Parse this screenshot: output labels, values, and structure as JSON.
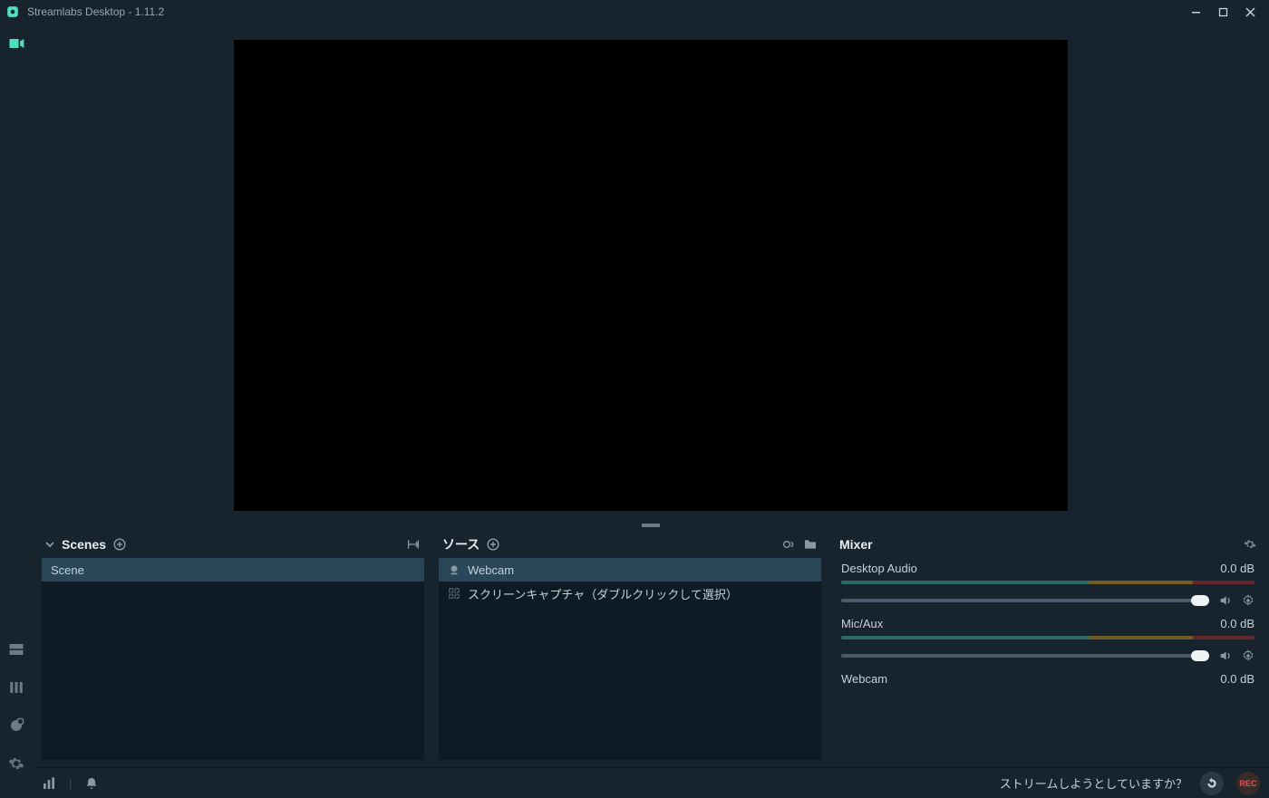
{
  "titlebar": {
    "title": "Streamlabs Desktop - 1.11.2"
  },
  "panels": {
    "scenes": {
      "title": "Scenes",
      "items": [
        {
          "label": "Scene"
        }
      ]
    },
    "sources": {
      "title": "ソース",
      "items": [
        {
          "icon": "webcam",
          "label": "Webcam"
        },
        {
          "icon": "screen",
          "label": "スクリーンキャプチャ（ダブルクリックして選択）"
        }
      ]
    },
    "mixer": {
      "title": "Mixer",
      "channels": [
        {
          "name": "Desktop Audio",
          "db": "0.0 dB"
        },
        {
          "name": "Mic/Aux",
          "db": "0.0 dB"
        },
        {
          "name": "Webcam",
          "db": "0.0 dB"
        }
      ]
    }
  },
  "footer": {
    "prompt": "ストリームしようとしていますか？",
    "rec_label": "REC"
  }
}
